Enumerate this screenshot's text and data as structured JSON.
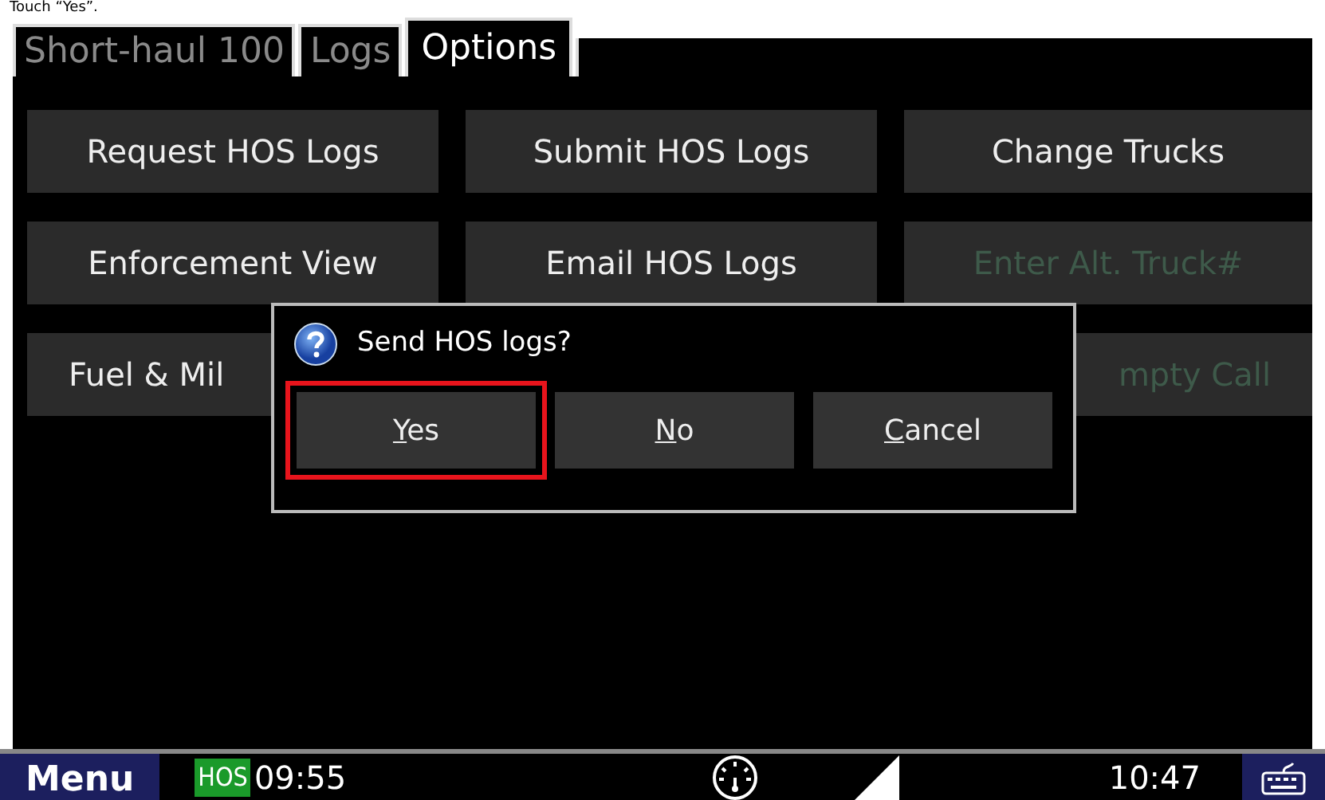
{
  "caption": "Touch “Yes”.",
  "tabs": [
    {
      "label": "Short-haul 100",
      "selected": false
    },
    {
      "label": "Logs",
      "selected": false
    },
    {
      "label": "Options",
      "selected": true
    }
  ],
  "option_buttons": [
    {
      "label": "Request HOS Logs",
      "disabled": false,
      "kind": "full"
    },
    {
      "label": "Submit HOS Logs",
      "disabled": false,
      "kind": "full"
    },
    {
      "label": "Change Trucks",
      "disabled": false,
      "kind": "full"
    },
    {
      "label": "Enforcement View",
      "disabled": false,
      "kind": "full"
    },
    {
      "label": "Email HOS Logs",
      "disabled": false,
      "kind": "full"
    },
    {
      "label": "Enter Alt. Truck#",
      "disabled": true,
      "kind": "full"
    },
    {
      "label": "Fuel & Mil",
      "disabled": false,
      "kind": "covered_right"
    },
    {
      "label": "mpty Call",
      "disabled": true,
      "kind": "covered_left"
    }
  ],
  "dialog": {
    "message": "Send HOS logs?",
    "buttons": [
      {
        "label": "Yes",
        "underline_first": true,
        "highlighted": true
      },
      {
        "label": "No",
        "underline_first": true,
        "highlighted": false
      },
      {
        "label": "Cancel",
        "underline_first": true,
        "highlighted": false
      }
    ]
  },
  "status_bar": {
    "menu": "Menu",
    "hos_badge": "HOS",
    "hos_time": "09:55",
    "clock": "10:47"
  }
}
